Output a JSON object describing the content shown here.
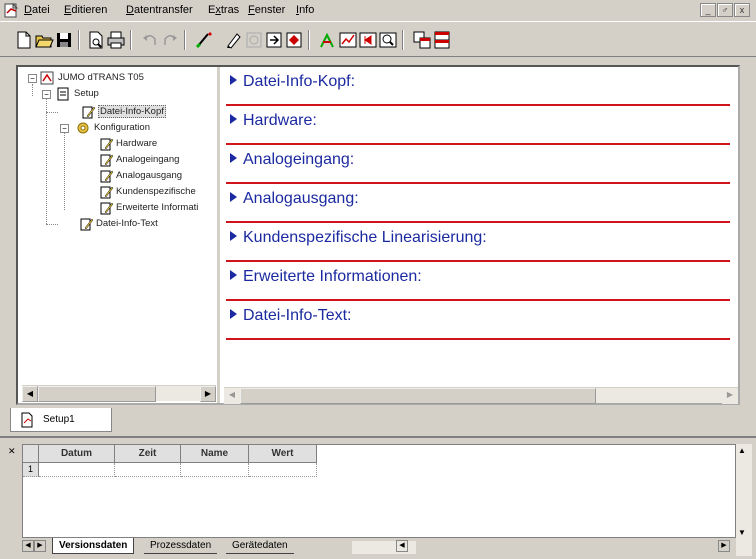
{
  "menu": {
    "items": [
      {
        "label": "Datei",
        "underline": "D",
        "rest": "atei"
      },
      {
        "label": "Editieren",
        "underline": "E",
        "rest": "ditieren"
      },
      {
        "label": "Datentransfer",
        "underline": "D",
        "rest": "atentransfer"
      },
      {
        "label": "Extras",
        "underline": "x",
        "prefix": "E",
        "rest": "tras"
      },
      {
        "label": "Fenster",
        "underline": "F",
        "rest": "enster"
      },
      {
        "label": "Info",
        "underline": "I",
        "rest": "nfo"
      }
    ],
    "window_buttons": [
      "_",
      "♂",
      "x"
    ]
  },
  "toolbar": {
    "icons": [
      "new-file-icon",
      "open-folder-icon",
      "save-icon",
      "print-preview-icon",
      "print-icon",
      "undo-icon",
      "redo-icon",
      "transfer-icon",
      "edit-icon",
      "disabled-icon",
      "download-icon",
      "upload-icon",
      "measure-icon",
      "chart-icon",
      "record-icon",
      "zoom-icon",
      "window-tile-icon",
      "window-cascade-icon"
    ]
  },
  "tree": {
    "root": "JUMO dTRANS T05",
    "setup": "Setup",
    "datei_info_kopf": "Datei-Info-Kopf",
    "konfiguration": "Konfiguration",
    "hardware": "Hardware",
    "analogeingang": "Analogeingang",
    "analogausgang": "Analogausgang",
    "kundenspezifische": "Kundenspezifische",
    "erweiterte": "Erweiterte Informati",
    "datei_info_text": "Datei-Info-Text"
  },
  "content": {
    "sections": [
      "Datei-Info-Kopf:",
      "Hardware:",
      "Analogeingang:",
      "Analogausgang:",
      "Kundenspezifische Linearisierung:",
      "Erweiterte Informationen:",
      "Datei-Info-Text:"
    ]
  },
  "doc_tab": {
    "label": "Setup1"
  },
  "grid": {
    "columns": [
      "Datum",
      "Zeit",
      "Name",
      "Wert"
    ],
    "row_number": "1"
  },
  "sheet_tabs": [
    "Versionsdaten",
    "Prozessdaten",
    "Gerätedaten"
  ],
  "colors": {
    "section_text": "#1b2aa0",
    "section_rule": "#d0141a",
    "chrome": "#d4d0c8"
  }
}
